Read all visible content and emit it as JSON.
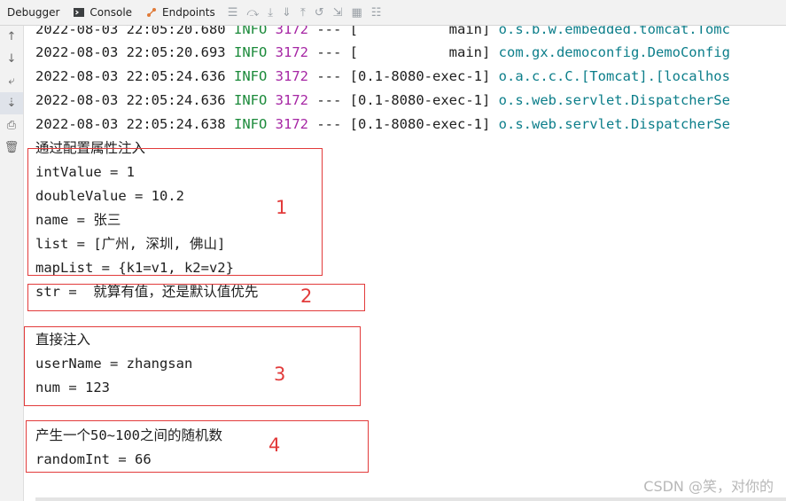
{
  "toolbar": {
    "tabs": [
      {
        "label": "Debugger"
      },
      {
        "label": "Console"
      },
      {
        "label": "Endpoints"
      }
    ]
  },
  "log": {
    "lines": [
      {
        "ts": "2022-08-03 22:05:20.680",
        "level": "INFO",
        "pid": "3172",
        "sep": "---",
        "thread": "[           main]",
        "logger": "o.s.b.w.embedded.tomcat.Tomc"
      },
      {
        "ts": "2022-08-03 22:05:20.693",
        "level": "INFO",
        "pid": "3172",
        "sep": "---",
        "thread": "[           main]",
        "logger": "com.gx.democonfig.DemoConfig"
      },
      {
        "ts": "2022-08-03 22:05:24.636",
        "level": "INFO",
        "pid": "3172",
        "sep": "---",
        "thread": "[0.1-8080-exec-1]",
        "logger": "o.a.c.c.C.[Tomcat].[localhos"
      },
      {
        "ts": "2022-08-03 22:05:24.636",
        "level": "INFO",
        "pid": "3172",
        "sep": "---",
        "thread": "[0.1-8080-exec-1]",
        "logger": "o.s.web.servlet.DispatcherSe"
      },
      {
        "ts": "2022-08-03 22:05:24.638",
        "level": "INFO",
        "pid": "3172",
        "sep": "---",
        "thread": "[0.1-8080-exec-1]",
        "logger": "o.s.web.servlet.DispatcherSe"
      }
    ],
    "output": [
      "通过配置属性注入",
      "intValue = 1",
      "doubleValue = 10.2",
      "name = 张三",
      "list = [广州, 深圳, 佛山]",
      "mapList = {k1=v1, k2=v2}",
      "str =  就算有值，还是默认值优先",
      "直接注入",
      "userName = zhangsan",
      "num = 123",
      "产生一个50~100之间的随机数",
      "randomInt = 66"
    ]
  },
  "annotations": {
    "labels": [
      "1",
      "2",
      "3",
      "4"
    ],
    "color": "#e23b3b"
  },
  "watermark": "CSDN @笑，对你的"
}
